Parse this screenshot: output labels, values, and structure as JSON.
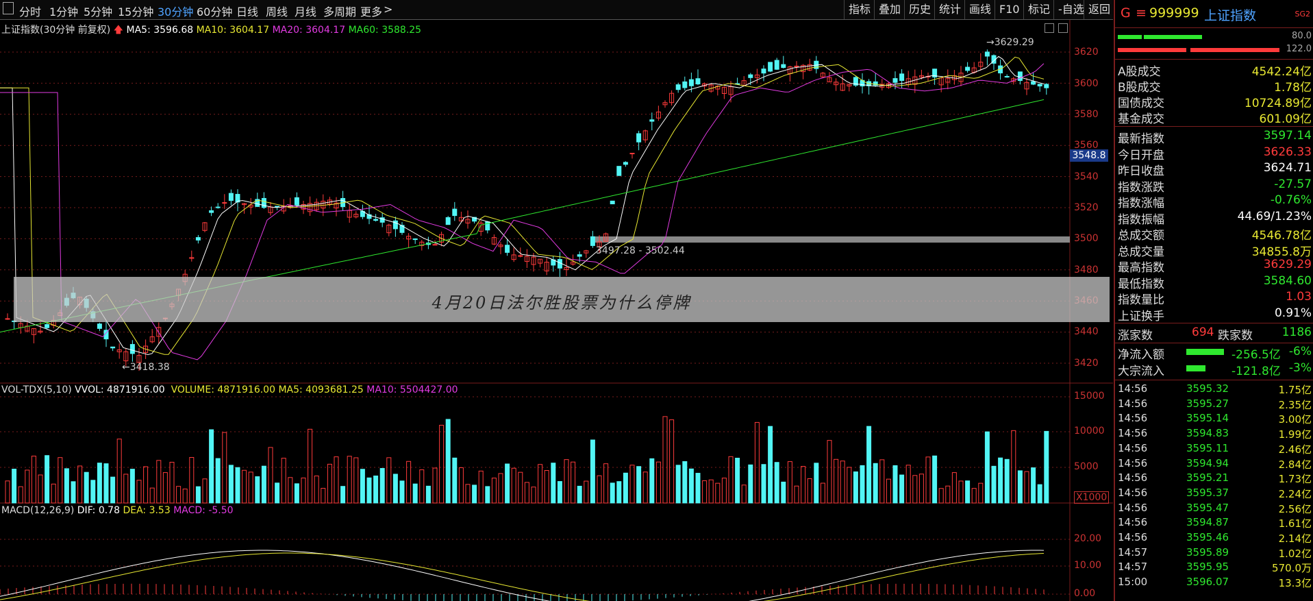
{
  "toolbar": {
    "periods": [
      "分时",
      "1分钟",
      "5分钟",
      "15分钟",
      "30分钟",
      "60分钟",
      "日线",
      "周线",
      "月线",
      "多周期",
      "更多"
    ],
    "active_period": "30分钟",
    "more_arrow": ">",
    "right_buttons": [
      "指标",
      "叠加",
      "历史",
      "统计",
      "画线",
      "F10",
      "标记",
      "-自选",
      "返回"
    ]
  },
  "chart_header": {
    "title": "上证指数(30分钟 前复权)",
    "ma5": "MA5: 3596.68",
    "ma10": "MA10: 3604.17",
    "ma20": "MA20: 3604.17",
    "ma60": "MA60: 3588.25"
  },
  "price_axis": [
    "3620",
    "3600",
    "3580",
    "3560",
    "3540",
    "3520",
    "3500",
    "3480",
    "3460",
    "3440",
    "3420"
  ],
  "current_price_tag": "3548.8",
  "annotations": {
    "high": "3629.29",
    "low": "3418.38",
    "range": "3497.28 - 3502.44"
  },
  "volume_header": {
    "name": "VOL-TDX(5,10)",
    "vvol": "VVOL: 4871916.00",
    "volume": "VOLUME: 4871916.00",
    "ma5": "MA5: 4093681.25",
    "ma10": "MA10: 5504427.00"
  },
  "volume_axis": [
    "15000",
    "10000",
    "5000"
  ],
  "volume_unit": "X1000",
  "macd_header": {
    "name": "MACD(12,26,9)",
    "dif": "DIF: 0.78",
    "dea": "DEA: 3.53",
    "macd": "MACD: -5.50"
  },
  "macd_axis": [
    "20.00",
    "10.00",
    "0.00"
  ],
  "overlay_text": "4月20日法尔胜股票为什么停牌",
  "panel": {
    "code_prefix": "G",
    "code": "999999",
    "name": "上证指数",
    "sg": "SG2",
    "bar1_value": "80.0",
    "bar2_value": "122.0",
    "turnover": [
      {
        "label": "A股成交",
        "value": "4542.24亿",
        "color": "yellow"
      },
      {
        "label": "B股成交",
        "value": "1.78亿",
        "color": "yellow"
      },
      {
        "label": "国债成交",
        "value": "10724.89亿",
        "color": "yellow"
      },
      {
        "label": "基金成交",
        "value": "601.09亿",
        "color": "yellow"
      }
    ],
    "stats": [
      {
        "label": "最新指数",
        "value": "3597.14",
        "color": "green"
      },
      {
        "label": "今日开盘",
        "value": "3626.33",
        "color": "red"
      },
      {
        "label": "昨日收盘",
        "value": "3624.71",
        "color": "white"
      },
      {
        "label": "指数涨跌",
        "value": "-27.57",
        "color": "green"
      },
      {
        "label": "指数涨幅",
        "value": "-0.76%",
        "color": "green"
      },
      {
        "label": "指数振幅",
        "value": "44.69/1.23%",
        "color": "white"
      },
      {
        "label": "总成交额",
        "value": "4546.78亿",
        "color": "yellow"
      },
      {
        "label": "总成交量",
        "value": "34855.8万",
        "color": "yellow"
      },
      {
        "label": "最高指数",
        "value": "3629.29",
        "color": "red"
      },
      {
        "label": "最低指数",
        "value": "3584.60",
        "color": "green"
      },
      {
        "label": "指数量比",
        "value": "1.03",
        "color": "red"
      },
      {
        "label": "上证换手",
        "value": "0.91%",
        "color": "white"
      }
    ],
    "up_label": "涨家数",
    "up_count": "694",
    "down_label": "跌家数",
    "down_count": "1186",
    "flows": [
      {
        "label": "净流入额",
        "value": "-256.5亿",
        "pct": "-6%"
      },
      {
        "label": "大宗流入",
        "value": "-121.8亿",
        "pct": "-3%"
      }
    ],
    "ticks": [
      {
        "t": "14:56",
        "p": "3595.32",
        "v": "1.75亿"
      },
      {
        "t": "14:56",
        "p": "3595.27",
        "v": "2.35亿"
      },
      {
        "t": "14:56",
        "p": "3595.14",
        "v": "3.00亿"
      },
      {
        "t": "14:56",
        "p": "3594.83",
        "v": "1.99亿"
      },
      {
        "t": "14:56",
        "p": "3595.11",
        "v": "2.46亿"
      },
      {
        "t": "14:56",
        "p": "3594.94",
        "v": "2.84亿"
      },
      {
        "t": "14:56",
        "p": "3595.21",
        "v": "1.73亿"
      },
      {
        "t": "14:56",
        "p": "3595.37",
        "v": "2.24亿"
      },
      {
        "t": "14:56",
        "p": "3595.47",
        "v": "2.56亿"
      },
      {
        "t": "14:56",
        "p": "3594.87",
        "v": "1.61亿"
      },
      {
        "t": "14:56",
        "p": "3595.46",
        "v": "2.14亿"
      },
      {
        "t": "14:57",
        "p": "3595.89",
        "v": "1.02亿"
      },
      {
        "t": "14:57",
        "p": "3595.95",
        "v": "570.0万"
      },
      {
        "t": "15:00",
        "p": "3596.07",
        "v": "13.3亿"
      }
    ]
  },
  "colors": {
    "up": "#ff3b3b",
    "down": "#52f5f5",
    "ma5": "#ffffff",
    "ma10": "#e8e832",
    "ma20": "#e23be2",
    "ma60": "#2fe82f",
    "grid": "#7a1d1d"
  },
  "chart_data": {
    "type": "candlestick",
    "price_range": [
      3410,
      3632
    ],
    "candles": [],
    "volume_range": [
      0,
      16000
    ],
    "macd_range": [
      -3,
      30
    ]
  }
}
